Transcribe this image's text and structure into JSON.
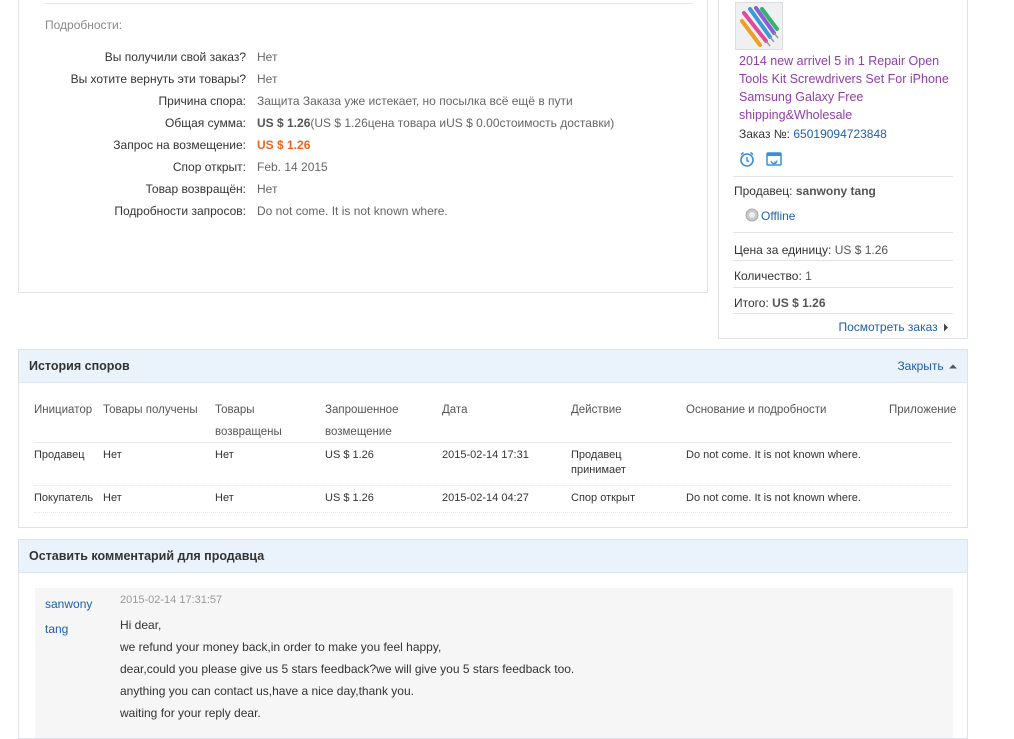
{
  "details": {
    "heading": "Подробности:",
    "rows": [
      {
        "label": "Вы получили свой заказ?",
        "value": "Нет"
      },
      {
        "label": "Вы хотите вернуть эти товары?",
        "value": "Нет"
      },
      {
        "label": "Причина спора:",
        "value": "Защита Заказа уже истекает, но посылка всё ещё в пути"
      },
      {
        "label": "Общая сумма:",
        "value_bold": "US $ 1.26",
        "value_rest": "(US $ 1.26цена товара иUS $ 0.00стоимость доставки)"
      },
      {
        "label": "Запрос на возмещение:",
        "value": "US $ 1.26"
      },
      {
        "label": "Спор открыт:",
        "value": "Feb. 14 2015"
      },
      {
        "label": "Товар возвращён:",
        "value": "Нет"
      },
      {
        "label": "Подробности запросов:",
        "value": "Do not come. It is not known where."
      }
    ]
  },
  "product": {
    "title": "2014 new arrivel 5 in 1 Repair Open Tools Kit Screwdrivers Set For iPhone Samsung Galaxy Free shipping&Wholesale",
    "order_label": "Заказ №:",
    "order_number": "65019094723848",
    "seller_label": "Продавец:",
    "seller_name": "sanwony tang",
    "status": "Offline",
    "unit_price_label": "Цена за единицу:",
    "unit_price": "US $ 1.26",
    "qty_label": "Количество:",
    "qty": "1",
    "total_label": "Итого:",
    "total": "US $ 1.26",
    "view_order": "Посмотреть заказ"
  },
  "history": {
    "title": "История споров",
    "close": "Закрыть",
    "columns": {
      "initiator": "Инициатор",
      "received": "Товары получены",
      "returned_1": "Товары",
      "returned_2": "возвращены",
      "requested_1": "Запрошенное",
      "requested_2": "возмещение",
      "date": "Дата",
      "action": "Действие",
      "reason": "Основание и подробности",
      "attachment": "Приложение"
    },
    "rows": [
      {
        "initiator": "Продавец",
        "received": "Нет",
        "returned": "Нет",
        "amount": "US $ 1.26",
        "date": "2015-02-14 17:31",
        "action_1": "Продавец",
        "action_2": "принимает",
        "reason": "Do not come. It is not known where."
      },
      {
        "initiator": "Покупатель",
        "received": "Нет",
        "returned": "Нет",
        "amount": "US $ 1.26",
        "date": "2015-02-14 04:27",
        "action_1": "Спор открыт",
        "action_2": "",
        "reason": "Do not come. It is not known where."
      }
    ]
  },
  "comments": {
    "title": "Оставить комментарий для продавца",
    "items": [
      {
        "author_1": "sanwony",
        "author_2": "tang",
        "time": "2015-02-14 17:31:57",
        "lines": [
          "Hi dear,",
          "we refund your money back,in order to make you feel happy,",
          "dear,could you please give us 5 stars feedback?we will give you 5 stars feedback too.",
          "anything you can contact us,have a nice day,thank you.",
          "waiting for your reply dear."
        ]
      }
    ]
  },
  "colors": {
    "accent_orange": "#f0641e",
    "link_blue": "#1e5fa8",
    "title_purple": "#8e3fa8",
    "header_bg": "#eaf2fb"
  }
}
